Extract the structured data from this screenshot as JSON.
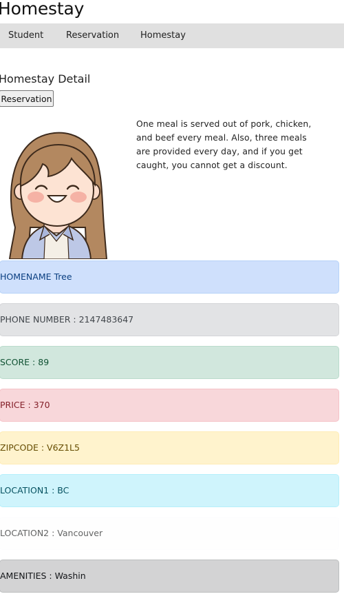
{
  "site": {
    "title": "Homestay"
  },
  "nav": {
    "items": [
      "Student",
      "Reservation",
      "Homestay"
    ]
  },
  "page": {
    "title": "Homestay Detail",
    "reservation_button": "Reservation",
    "description": "One meal is served out of pork, chicken, and beef every meal. Also, three meals are provided every day, and if you get caught, you cannot get a discount."
  },
  "details": [
    {
      "text": "HOMENAME Tree",
      "bg": "#cfe0fc",
      "border": "#b6d2f8",
      "color": "#0a3e80"
    },
    {
      "text": "PHONE NUMBER : 2147483647",
      "bg": "#e2e3e5",
      "border": "#d4d5d8",
      "color": "#41464b"
    },
    {
      "text": "SCORE : 89",
      "bg": "#d1e7dd",
      "border": "#badbcc",
      "color": "#0f5132"
    },
    {
      "text": "PRICE : 370",
      "bg": "#f8d7da",
      "border": "#f5c2c7",
      "color": "#842029"
    },
    {
      "text": "ZIPCODE : V6Z1L5",
      "bg": "#fff3cd",
      "border": "#ffecb5",
      "color": "#664d03"
    },
    {
      "text": "LOCATION1 : BC",
      "bg": "#cff4fc",
      "border": "#b6effb",
      "color": "#055160"
    },
    {
      "text": "LOCATION2 : Vancouver",
      "bg": "#fefefe",
      "border": "#fdfdfe",
      "color": "#636464"
    },
    {
      "text": "AMENITIES : Washin",
      "bg": "#d3d3d4",
      "border": "#bcbebf",
      "color": "#141619"
    }
  ]
}
